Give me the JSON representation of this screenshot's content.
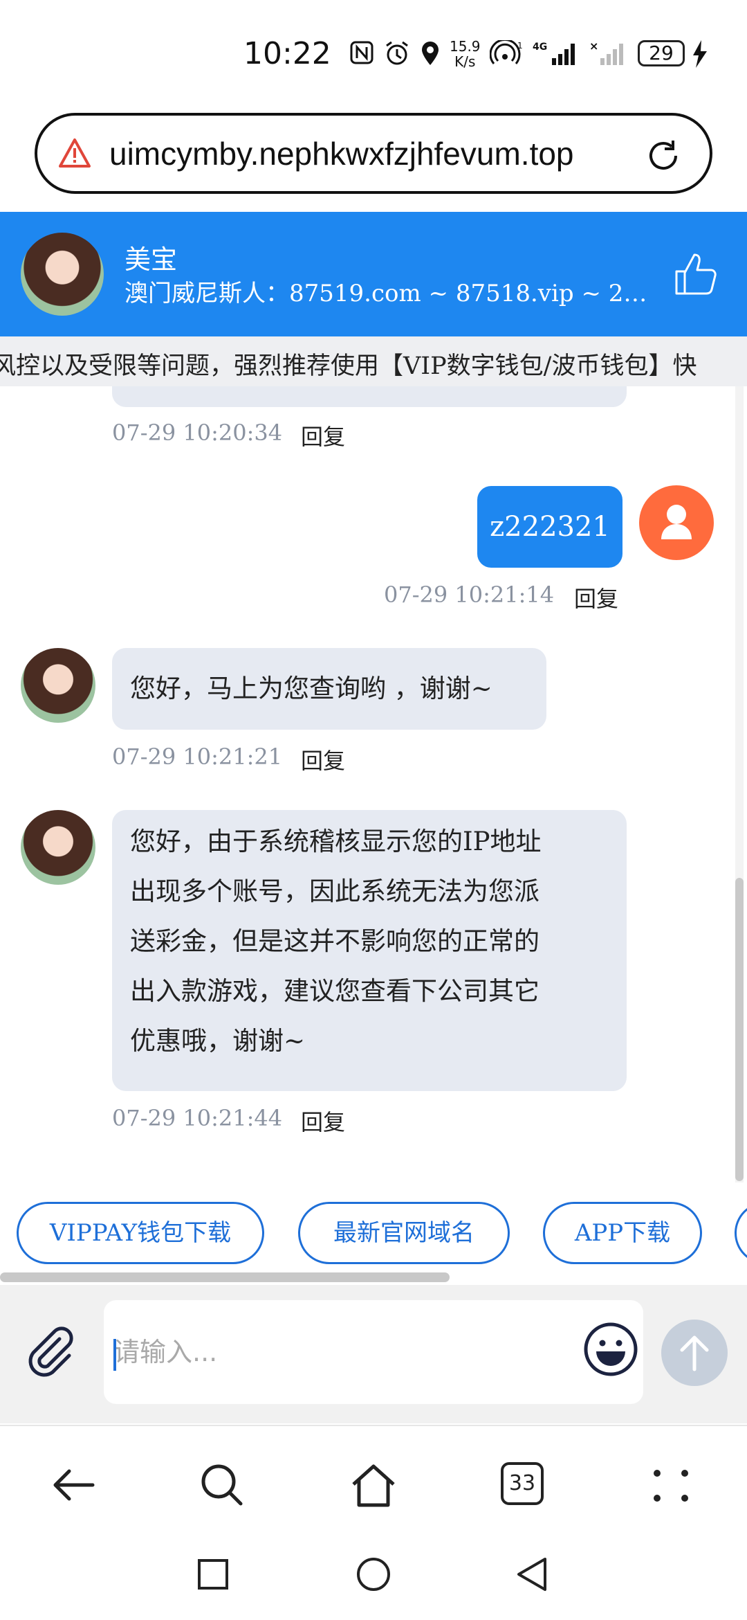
{
  "status_bar": {
    "time": "10:22",
    "speed_top": "15.9",
    "speed_bottom": "K/s",
    "battery": "29"
  },
  "browser": {
    "url": "uimcymby.nephkwxfzjhfevum.top",
    "tabs_count": "33"
  },
  "chat_header": {
    "name": "美宝",
    "subtitle": "澳门威尼斯人：87519.com ~ 87518.vip ~ 24..."
  },
  "marquee": {
    "text": "风控以及受限等问题，强烈推荐使用【VIP数字钱包/波币钱包】快"
  },
  "messages": [
    {
      "time": "07-29 10:20:34",
      "reply": "回复"
    },
    {
      "text": "z222321",
      "time": "07-29 10:21:14",
      "reply": "回复"
    },
    {
      "text": "您好，马上为您查询哟 ，谢谢~",
      "time": "07-29 10:21:21",
      "reply": "回复"
    },
    {
      "lines": [
        "您好，由于系统稽核显示您的IP地址",
        "出现多个账号，因此系统无法为您派",
        "送彩金，但是这并不影响您的正常的",
        "出入款游戏，建议您查看下公司其它",
        "优惠哦，谢谢~"
      ],
      "time": "07-29 10:21:44",
      "reply": "回复"
    }
  ],
  "quick_buttons": [
    "VIPPAY钱包下载",
    "最新官网域名",
    "APP下载"
  ],
  "input": {
    "placeholder": "请输入..."
  },
  "colors": {
    "header_blue": "#1e87f0",
    "bubble_grey": "#e6eaf2",
    "user_avatar_orange": "#ff6b3d",
    "quick_button_blue": "#1e6fd8"
  }
}
